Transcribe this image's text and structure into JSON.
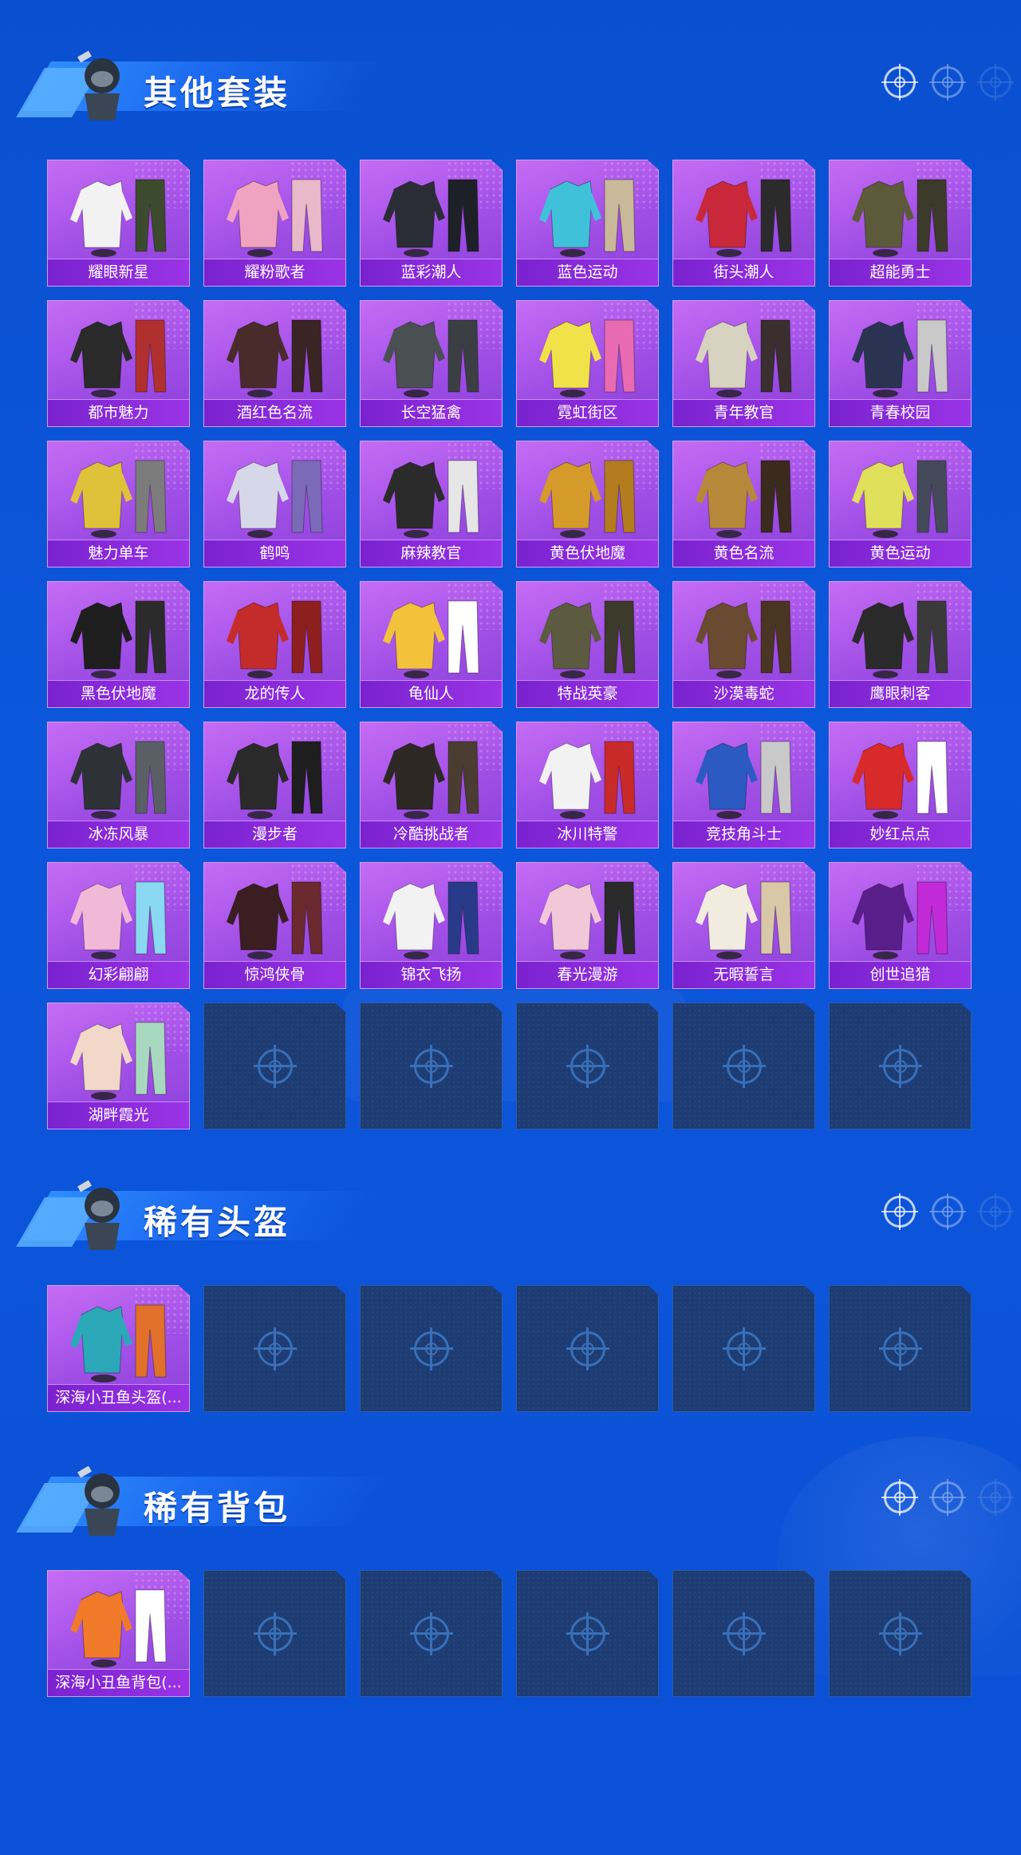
{
  "sections": [
    {
      "title": "其他套装",
      "items": [
        {
          "label": "耀眼新星",
          "palette": [
            "#f2f2f2",
            "#3c4a2e"
          ]
        },
        {
          "label": "耀粉歌者",
          "palette": [
            "#f0a3c0",
            "#e8b9c9"
          ]
        },
        {
          "label": "蓝彩潮人",
          "palette": [
            "#2a2d36",
            "#1e2028"
          ]
        },
        {
          "label": "蓝色运动",
          "palette": [
            "#3fc2d9",
            "#c9b89a"
          ]
        },
        {
          "label": "街头潮人",
          "palette": [
            "#c8283a",
            "#2b2b2b"
          ]
        },
        {
          "label": "超能勇士",
          "palette": [
            "#5c5a3b",
            "#3c3a2a"
          ]
        },
        {
          "label": "都市魅力",
          "palette": [
            "#2a2a2a",
            "#b03030"
          ]
        },
        {
          "label": "酒红色名流",
          "palette": [
            "#4a2b2b",
            "#3a2424"
          ]
        },
        {
          "label": "长空猛禽",
          "palette": [
            "#4a4f52",
            "#3b3f44"
          ]
        },
        {
          "label": "霓虹街区",
          "palette": [
            "#f2e24a",
            "#e86bb1"
          ]
        },
        {
          "label": "青年教官",
          "palette": [
            "#d8d2c0",
            "#3a2e2e"
          ]
        },
        {
          "label": "青春校园",
          "palette": [
            "#2a3452",
            "#c9c9c9"
          ]
        },
        {
          "label": "魅力单车",
          "palette": [
            "#e0c23a",
            "#7c7c7c"
          ]
        },
        {
          "label": "鹤鸣",
          "palette": [
            "#d7d7ea",
            "#7a6ab8"
          ]
        },
        {
          "label": "麻辣教官",
          "palette": [
            "#2b2b2b",
            "#e6e6e6"
          ]
        },
        {
          "label": "黄色伏地魔",
          "palette": [
            "#d49a2a",
            "#b37c1f"
          ]
        },
        {
          "label": "黄色名流",
          "palette": [
            "#b8883a",
            "#3b2a1e"
          ]
        },
        {
          "label": "黄色运动",
          "palette": [
            "#e0e05a",
            "#444a5a"
          ]
        },
        {
          "label": "黑色伏地魔",
          "palette": [
            "#1e1e1e",
            "#2b2b2b"
          ]
        },
        {
          "label": "龙的传人",
          "palette": [
            "#c42b2b",
            "#8e1f1f"
          ]
        },
        {
          "label": "龟仙人",
          "palette": [
            "#f2c23a",
            "#ffffff"
          ]
        },
        {
          "label": "特战英豪",
          "palette": [
            "#5c5a40",
            "#3c3a2a"
          ]
        },
        {
          "label": "沙漠毒蛇",
          "palette": [
            "#6a4a30",
            "#4a3422"
          ]
        },
        {
          "label": "鹰眼刺客",
          "palette": [
            "#2a2a2a",
            "#3a3a3a"
          ]
        },
        {
          "label": "冰冻风暴",
          "palette": [
            "#2e3236",
            "#5a5f66"
          ]
        },
        {
          "label": "漫步者",
          "palette": [
            "#2a2a2a",
            "#1e1e1e"
          ]
        },
        {
          "label": "冷酷挑战者",
          "palette": [
            "#2e2824",
            "#4a3c30"
          ]
        },
        {
          "label": "冰川特警",
          "palette": [
            "#f2f2f2",
            "#c82a2a"
          ]
        },
        {
          "label": "竞技角斗士",
          "palette": [
            "#2a5ac2",
            "#c9c9c9"
          ]
        },
        {
          "label": "妙红点点",
          "palette": [
            "#d82a2a",
            "#ffffff"
          ]
        },
        {
          "label": "幻彩翩翩",
          "palette": [
            "#f2b8d8",
            "#8ad8f2"
          ]
        },
        {
          "label": "惊鸿侠骨",
          "palette": [
            "#3a1e22",
            "#6a2a30"
          ]
        },
        {
          "label": "锦衣飞扬",
          "palette": [
            "#f2f2f2",
            "#2a3a8a"
          ]
        },
        {
          "label": "春光漫游",
          "palette": [
            "#f2c8d8",
            "#2a2a2a"
          ]
        },
        {
          "label": "无暇誓言",
          "palette": [
            "#f2ece0",
            "#d8c8a8"
          ]
        },
        {
          "label": "创世追猎",
          "palette": [
            "#5a1e8a",
            "#c22ad8"
          ]
        },
        {
          "label": "湖畔霞光",
          "palette": [
            "#f2d8c8",
            "#a8d8c0"
          ]
        }
      ],
      "empty_count": 5
    },
    {
      "title": "稀有头盔",
      "items": [
        {
          "label": "深海小丑鱼头盔(...",
          "palette": [
            "#2aa8b8",
            "#e0702a"
          ]
        }
      ],
      "empty_count": 5
    },
    {
      "title": "稀有背包",
      "items": [
        {
          "label": "深海小丑鱼背包(...",
          "palette": [
            "#f07a2a",
            "#ffffff"
          ]
        }
      ],
      "empty_count": 5
    }
  ]
}
